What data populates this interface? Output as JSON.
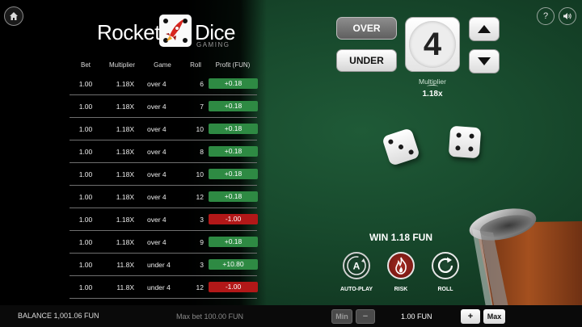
{
  "brand": {
    "word1": "Rocket",
    "word2": "Dice",
    "sub": "GAMING"
  },
  "header": {
    "help_label": "?"
  },
  "history": {
    "columns": [
      "Bet",
      "Multiplier",
      "Game",
      "Roll",
      "Profit (FUN)"
    ],
    "rows": [
      {
        "bet": "1.00",
        "multiplier": "1.18X",
        "game": "over 4",
        "roll": "6",
        "profit": "+0.18",
        "result": "win"
      },
      {
        "bet": "1.00",
        "multiplier": "1.18X",
        "game": "over 4",
        "roll": "7",
        "profit": "+0.18",
        "result": "win"
      },
      {
        "bet": "1.00",
        "multiplier": "1.18X",
        "game": "over 4",
        "roll": "10",
        "profit": "+0.18",
        "result": "win"
      },
      {
        "bet": "1.00",
        "multiplier": "1.18X",
        "game": "over 4",
        "roll": "8",
        "profit": "+0.18",
        "result": "win"
      },
      {
        "bet": "1.00",
        "multiplier": "1.18X",
        "game": "over 4",
        "roll": "10",
        "profit": "+0.18",
        "result": "win"
      },
      {
        "bet": "1.00",
        "multiplier": "1.18X",
        "game": "over 4",
        "roll": "12",
        "profit": "+0.18",
        "result": "win"
      },
      {
        "bet": "1.00",
        "multiplier": "1.18X",
        "game": "over 4",
        "roll": "3",
        "profit": "-1.00",
        "result": "lose"
      },
      {
        "bet": "1.00",
        "multiplier": "1.18X",
        "game": "over 4",
        "roll": "9",
        "profit": "+0.18",
        "result": "win"
      },
      {
        "bet": "1.00",
        "multiplier": "11.8X",
        "game": "under 4",
        "roll": "3",
        "profit": "+10.80",
        "result": "win"
      },
      {
        "bet": "1.00",
        "multiplier": "11.8X",
        "game": "under 4",
        "roll": "12",
        "profit": "-1.00",
        "result": "lose"
      }
    ]
  },
  "controls": {
    "over_label": "OVER",
    "under_label": "UNDER",
    "selected_mode": "OVER",
    "target_number": "4",
    "multiplier_label": "Multiplier",
    "multiplier_value": "1.18x"
  },
  "dice": [
    {
      "value": 3
    },
    {
      "value": 4
    }
  ],
  "result": {
    "win_text": "WIN 1.18 FUN"
  },
  "actions": {
    "autoplay_label": "AUTO-PLAY",
    "risk_label": "RISK",
    "roll_label": "ROLL"
  },
  "footer": {
    "balance": "BALANCE 1,001.06 FUN",
    "max_bet": "Max bet 100.00 FUN",
    "min_label": "Min",
    "minus_label": "−",
    "bet_amount": "1.00 FUN",
    "plus_label": "+",
    "max_label": "Max"
  },
  "colors": {
    "felt": "#1f5a37",
    "win_pill": "#2e8a43",
    "lose_pill": "#b21818",
    "risk_button": "#a32a22"
  }
}
